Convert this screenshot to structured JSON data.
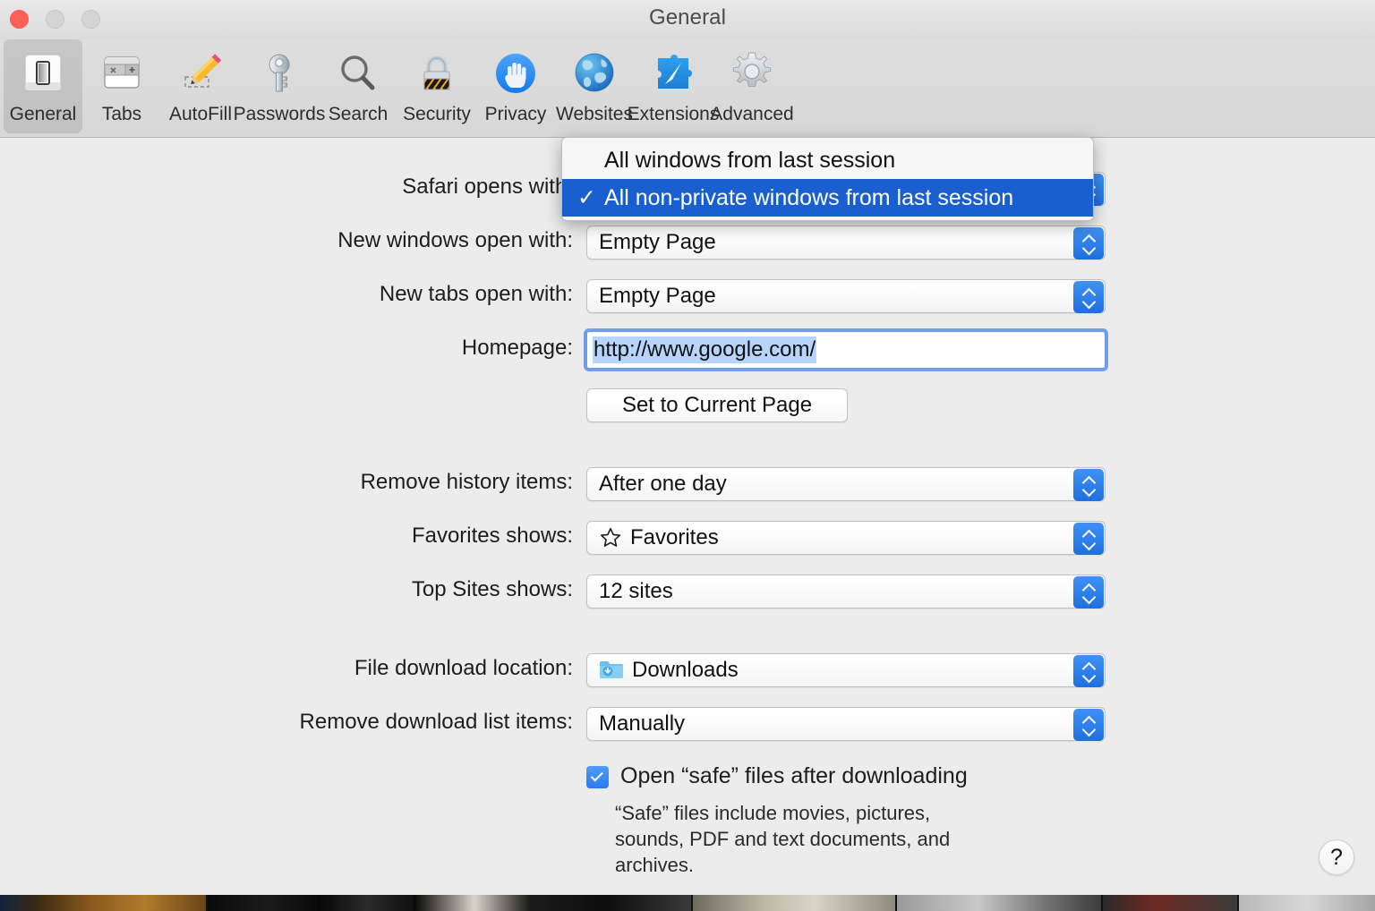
{
  "window": {
    "title": "General",
    "traffic_lights": [
      "close",
      "minimize",
      "maximize"
    ]
  },
  "toolbar": {
    "items": [
      {
        "label": "General",
        "icon": "general-switch-icon",
        "selected": true
      },
      {
        "label": "Tabs",
        "icon": "tabs-icon",
        "selected": false
      },
      {
        "label": "AutoFill",
        "icon": "pencil-autofill-icon",
        "selected": false
      },
      {
        "label": "Passwords",
        "icon": "key-icon",
        "selected": false
      },
      {
        "label": "Search",
        "icon": "magnifier-icon",
        "selected": false
      },
      {
        "label": "Security",
        "icon": "padlock-icon",
        "selected": false
      },
      {
        "label": "Privacy",
        "icon": "hand-icon",
        "selected": false
      },
      {
        "label": "Websites",
        "icon": "globe-icon",
        "selected": false
      },
      {
        "label": "Extensions",
        "icon": "puzzle-compass-icon",
        "selected": false
      },
      {
        "label": "Advanced",
        "icon": "gear-icon",
        "selected": false
      }
    ]
  },
  "form": {
    "safari_opens_with": {
      "label": "Safari opens with:",
      "value": "All non-private windows from last session"
    },
    "new_windows_open_with": {
      "label": "New windows open with:",
      "value": "Empty Page"
    },
    "new_tabs_open_with": {
      "label": "New tabs open with:",
      "value": "Empty Page"
    },
    "homepage": {
      "label": "Homepage:",
      "value": "http://www.google.com/",
      "placeholder": "http://www.google.com/"
    },
    "set_to_current_page": {
      "label": "Set to Current Page"
    },
    "remove_history_items": {
      "label": "Remove history items:",
      "value": "After one day"
    },
    "favorites_shows": {
      "label": "Favorites shows:",
      "value": "Favorites",
      "icon": "star-icon"
    },
    "top_sites_shows": {
      "label": "Top Sites shows:",
      "value": "12 sites"
    },
    "file_download_location": {
      "label": "File download location:",
      "value": "Downloads",
      "icon": "downloads-folder-icon"
    },
    "remove_download_list_items": {
      "label": "Remove download list items:",
      "value": "Manually"
    },
    "open_safe_files": {
      "label": "Open “safe” files after downloading",
      "checked": true,
      "description": "“Safe” files include movies, pictures, sounds, PDF and text documents, and archives."
    }
  },
  "popup_menu": {
    "open": true,
    "items": [
      {
        "label": "All windows from last session",
        "checked": false
      },
      {
        "label": "All non-private windows from last session",
        "checked": true
      }
    ],
    "check_glyph": "✓"
  },
  "help_button": {
    "label": "?"
  },
  "colors": {
    "accent_blue": "#1f6fe0",
    "menu_highlight": "#1a5fd0",
    "window_bg": "#ececec",
    "toolbar_bg": "#d9d9d9",
    "selection_blue": "#b7d5fb"
  }
}
